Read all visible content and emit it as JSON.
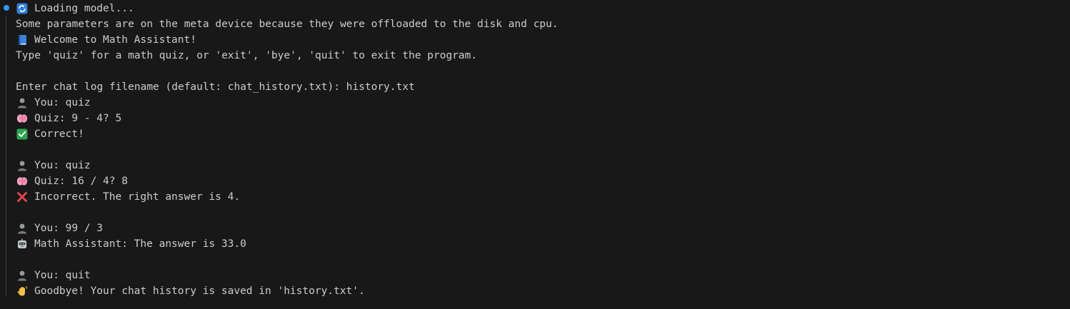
{
  "terminal": {
    "lines": [
      {
        "icon": "refresh-icon",
        "text": "Loading model..."
      },
      {
        "icon": "",
        "text": "Some parameters are on the meta device because they were offloaded to the disk and cpu."
      },
      {
        "icon": "book-icon",
        "text": "Welcome to Math Assistant!"
      },
      {
        "icon": "",
        "text": "Type 'quiz' for a math quiz, or 'exit', 'bye', 'quit' to exit the program."
      },
      {
        "icon": "",
        "text": ""
      },
      {
        "icon": "",
        "text": "Enter chat log filename (default: chat_history.txt): history.txt"
      },
      {
        "icon": "user-icon",
        "text": "You: quiz"
      },
      {
        "icon": "brain-icon",
        "text": "Quiz: 9 - 4? 5"
      },
      {
        "icon": "check-icon",
        "text": "Correct!"
      },
      {
        "icon": "",
        "text": ""
      },
      {
        "icon": "user-icon",
        "text": "You: quiz"
      },
      {
        "icon": "brain-icon",
        "text": "Quiz: 16 / 4? 8"
      },
      {
        "icon": "cross-icon",
        "text": "Incorrect. The right answer is 4."
      },
      {
        "icon": "",
        "text": ""
      },
      {
        "icon": "user-icon",
        "text": "You: 99 / 3"
      },
      {
        "icon": "robot-icon",
        "text": "Math Assistant: The answer is 33.0"
      },
      {
        "icon": "",
        "text": ""
      },
      {
        "icon": "user-icon",
        "text": "You: quit"
      },
      {
        "icon": "wave-icon",
        "text": "Goodbye! Your chat history is saved in 'history.txt'."
      }
    ]
  },
  "colors": {
    "background": "#181818",
    "text": "#cccccc",
    "status_dot": "#3794ff"
  }
}
